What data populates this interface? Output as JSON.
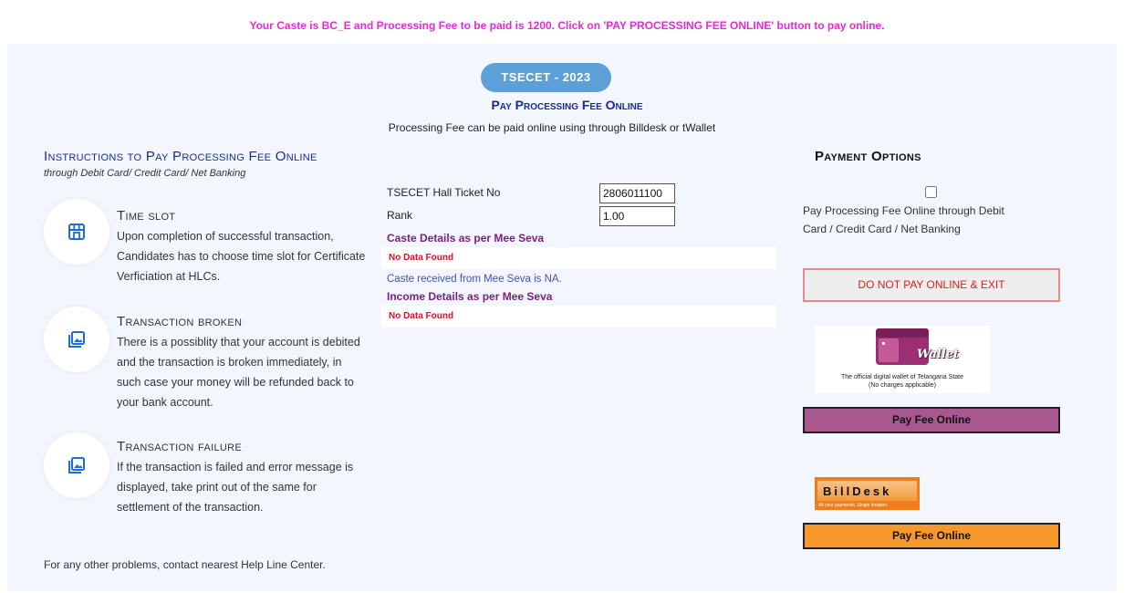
{
  "notice": "Your Caste is BC_E and Processing Fee to be paid is 1200. Click on 'PAY PROCESSING FEE ONLINE' button to pay online.",
  "header": {
    "badge": "TSECET - 2023",
    "title": "Pay Processing Fee Online",
    "subtitle": "Processing Fee can be paid online using through Billdesk or tWallet"
  },
  "instructions": {
    "heading": "Instructions to Pay Processing Fee Online",
    "subheading": "through Debit Card/ Credit Card/ Net Banking",
    "items": [
      {
        "title": "Time slot",
        "text": "Upon completion of successful transaction, Candidates has to choose time slot for Certificate Verficiation at HLCs.",
        "icon": "store-icon"
      },
      {
        "title": "Transaction broken",
        "text": "There is a possiblity that your account is debited and the transaction is broken immediately, in such case your money will be refunded back to your bank account.",
        "icon": "image-gallery-icon"
      },
      {
        "title": "Transaction failure",
        "text": "If the transaction is failed and error message is displayed, take print out of the same for settlement of the transaction.",
        "icon": "image-gallery-icon"
      }
    ],
    "footer": "For any other problems, contact nearest Help Line Center."
  },
  "form": {
    "hall_ticket_label": "TSECET Hall Ticket No",
    "hall_ticket_value": "2806011100",
    "rank_label": "Rank",
    "rank_value": "1.00",
    "caste_heading": "Caste Details as per Mee Seva",
    "caste_nodata": "No Data Found",
    "caste_message": "Caste received from Mee Seva is NA.",
    "income_heading": "Income Details as per Mee Seva",
    "income_nodata": "No Data Found"
  },
  "payment": {
    "heading": "Payment Options",
    "checkbox_label": "Pay Processing Fee Online through Debit Card / Credit Card / Net Banking",
    "checkbox_checked": false,
    "exit_button": "DO NOT PAY ONLINE & EXIT",
    "twallet": {
      "logo_word": "Wallet",
      "caption_line1": "The official digital wallet of Telangana State",
      "caption_line2": "(No charges applicable)",
      "button": "Pay Fee Online"
    },
    "billdesk": {
      "logo_word": "BillDesk",
      "tagline": "All your payments. Single location.",
      "button": "Pay Fee Online"
    }
  },
  "colors": {
    "notice": "#e62ad6",
    "badge": "#5da0d8",
    "title": "#1a2a9a",
    "section_heading": "#7d1e86",
    "no_data": "#e0102a",
    "caste_message": "#3d4ed6",
    "twallet_button": "#a8588f",
    "billdesk_button": "#f7982c",
    "icon": "#1e6fd0"
  }
}
